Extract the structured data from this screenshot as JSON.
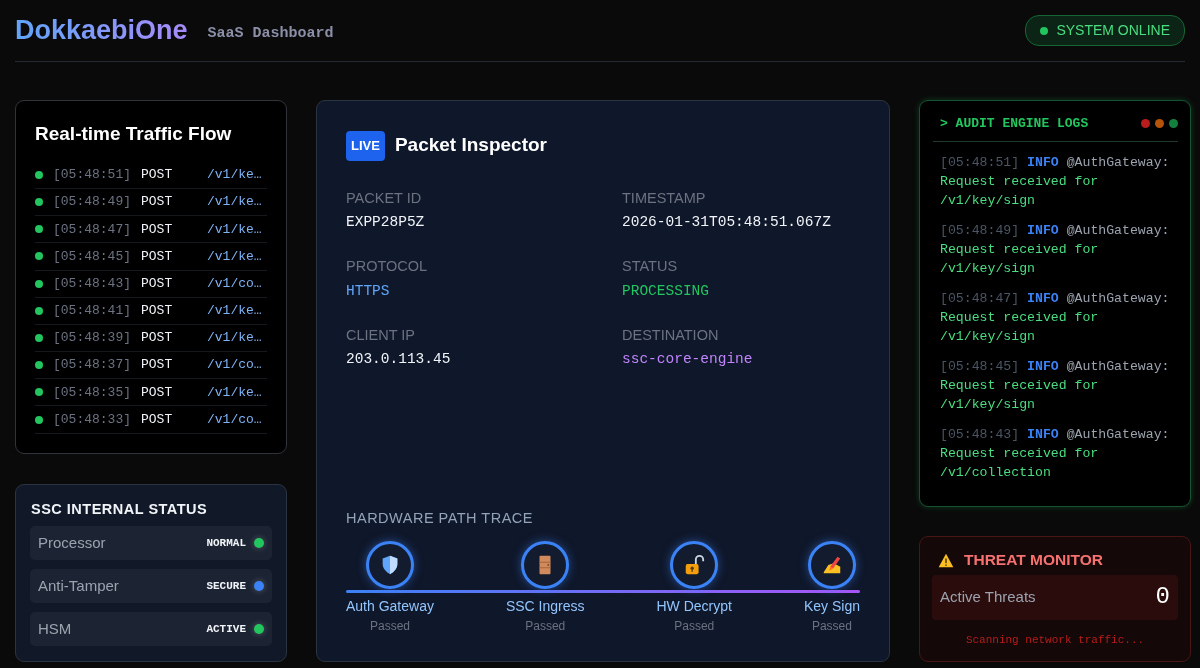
{
  "header": {
    "brand": "DokkaebiOne",
    "subtitle": "SaaS Dashboard",
    "system_badge": {
      "label": "SYSTEM ONLINE",
      "online": true
    }
  },
  "traffic": {
    "title": "Real-time Traffic Flow",
    "rows": [
      {
        "time": "[05:48:51]",
        "method": "POST",
        "path": "/v1/ke…"
      },
      {
        "time": "[05:48:49]",
        "method": "POST",
        "path": "/v1/ke…"
      },
      {
        "time": "[05:48:47]",
        "method": "POST",
        "path": "/v1/ke…"
      },
      {
        "time": "[05:48:45]",
        "method": "POST",
        "path": "/v1/ke…"
      },
      {
        "time": "[05:48:43]",
        "method": "POST",
        "path": "/v1/co…"
      },
      {
        "time": "[05:48:41]",
        "method": "POST",
        "path": "/v1/ke…"
      },
      {
        "time": "[05:48:39]",
        "method": "POST",
        "path": "/v1/ke…"
      },
      {
        "time": "[05:48:37]",
        "method": "POST",
        "path": "/v1/co…"
      },
      {
        "time": "[05:48:35]",
        "method": "POST",
        "path": "/v1/ke…"
      },
      {
        "time": "[05:48:33]",
        "method": "POST",
        "path": "/v1/co…"
      }
    ]
  },
  "internal_status": {
    "title": "SSC INTERNAL STATUS",
    "items": [
      {
        "name": "Processor",
        "value": "NORMAL",
        "color": "#22c55e"
      },
      {
        "name": "Anti-Tamper",
        "value": "SECURE",
        "color": "#3b82f6"
      },
      {
        "name": "HSM",
        "value": "ACTIVE",
        "color": "#22c55e"
      }
    ]
  },
  "inspector": {
    "badge": "LIVE",
    "title": "Packet Inspector",
    "fields": [
      {
        "label": "PACKET ID",
        "value": "EXPP28P5Z",
        "color": "#f1f5f9"
      },
      {
        "label": "TIMESTAMP",
        "value": "2026-01-31T05:48:51.067Z",
        "color": "#f1f5f9"
      },
      {
        "label": "PROTOCOL",
        "value": "HTTPS",
        "color": "#60a5fa"
      },
      {
        "label": "STATUS",
        "value": "PROCESSING",
        "color": "#22c55e"
      },
      {
        "label": "CLIENT IP",
        "value": "203.0.113.45",
        "color": "#f1f5f9"
      },
      {
        "label": "DESTINATION",
        "value": "ssc-core-engine",
        "color": "#c084fc"
      }
    ],
    "trace": {
      "title": "HARDWARE PATH TRACE",
      "steps": [
        {
          "kind": "shield",
          "label": "Auth Gateway",
          "status": "Passed"
        },
        {
          "kind": "door",
          "label": "SSC Ingress",
          "status": "Passed"
        },
        {
          "kind": "padlock",
          "label": "HW Decrypt",
          "status": "Passed"
        },
        {
          "kind": "pen",
          "label": "Key Sign",
          "status": "Passed"
        }
      ]
    }
  },
  "audit_logs": {
    "title": "> AUDIT ENGINE LOGS",
    "entries": [
      {
        "time": "[05:48:51]",
        "level": "INFO",
        "source": "@AuthGateway:",
        "message": "Request received for /v1/key/sign"
      },
      {
        "time": "[05:48:49]",
        "level": "INFO",
        "source": "@AuthGateway:",
        "message": "Request received for /v1/key/sign"
      },
      {
        "time": "[05:48:47]",
        "level": "INFO",
        "source": "@AuthGateway:",
        "message": "Request received for /v1/key/sign"
      },
      {
        "time": "[05:48:45]",
        "level": "INFO",
        "source": "@AuthGateway:",
        "message": "Request received for /v1/key/sign"
      },
      {
        "time": "[05:48:43]",
        "level": "INFO",
        "source": "@AuthGateway:",
        "message": "Request received for /v1/collection"
      }
    ]
  },
  "threat_monitor": {
    "title": "THREAT MONITOR",
    "metric_label": "Active Threats",
    "metric_value": "0",
    "footer": "Scanning network traffic..."
  }
}
